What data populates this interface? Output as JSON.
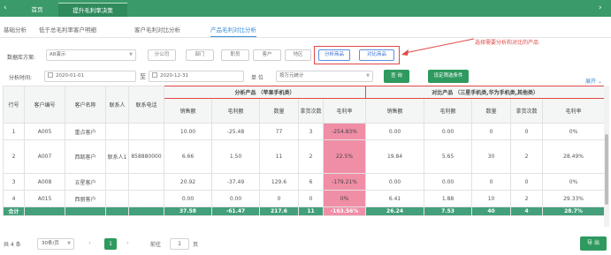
{
  "topbar": {
    "back_icon": "‹",
    "forward_icon": "›",
    "tabs": [
      {
        "label": "首页"
      },
      {
        "label": "提升毛利率决策"
      }
    ]
  },
  "subtabs": [
    "基础分析",
    "低于总毛利率客户明细",
    "客户毛利对比分析",
    "产品毛利对比分析"
  ],
  "filters": {
    "scheme_label": "数据库方案:",
    "scheme_value": "A8演示",
    "dims": [
      "分公司",
      "部门",
      "职员",
      "客户",
      "地区"
    ],
    "analysis_btn": "分析商品",
    "compare_btn": "对比商品",
    "annotation": "选择需要分析和对比的产品",
    "time_label": "分析时间:",
    "date_from": "2020-01-01",
    "to_label": "至",
    "date_to": "2020-12-31",
    "unit_label": "单 位",
    "unit_value": "按万元统计",
    "query_btn": "查 询",
    "set_cond_btn": "设定筛选条件",
    "expand": "展开"
  },
  "table": {
    "group_analysis": "分析产品 （苹果手机类）",
    "group_compare": "对比产品 （三星手机类,华为手机类,其他类）",
    "fixed_headers": [
      "行号",
      "客户编号",
      "客户名称",
      "联系人",
      "联系电话"
    ],
    "metric_headers": [
      "销售额",
      "毛利额",
      "数量",
      "拿货次数",
      "毛利率"
    ],
    "rows": [
      {
        "no": "1",
        "code": "A005",
        "name": "重点客户",
        "contact": "",
        "phone": "",
        "a": [
          "10.00",
          "-25.48",
          "77",
          "3",
          "-254.83%"
        ],
        "c": [
          "0.00",
          "0.00",
          "0",
          "0",
          "0%"
        ]
      },
      {
        "no": "2",
        "code": "A007",
        "name": "西瓯客户",
        "contact": "联系人1",
        "phone": "858880000",
        "a": [
          "6.66",
          "1.50",
          "11",
          "2",
          "22.5%"
        ],
        "c": [
          "19.84",
          "5.65",
          "30",
          "2",
          "28.49%"
        ]
      },
      {
        "no": "3",
        "code": "A008",
        "name": "五星客户",
        "contact": "",
        "phone": "",
        "a": [
          "20.92",
          "-37.49",
          "129.6",
          "6",
          "-179.21%"
        ],
        "c": [
          "0.00",
          "0.00",
          "0",
          "0",
          "0%"
        ]
      },
      {
        "no": "4",
        "code": "A015",
        "name": "西丽客户",
        "contact": "",
        "phone": "",
        "a": [
          "0.00",
          "0.00",
          "0",
          "0",
          "0%"
        ],
        "c": [
          "6.41",
          "1.88",
          "10",
          "2",
          "29.33%"
        ]
      }
    ],
    "total": {
      "label": "合计",
      "a": [
        "37.58",
        "-61.47",
        "217.6",
        "11",
        "-163.56%"
      ],
      "c": [
        "26.24",
        "7.53",
        "40",
        "4",
        "28.7%"
      ]
    }
  },
  "pager": {
    "total": "共 4 条",
    "per_page": "30条/页",
    "prev": "‹",
    "page": "1",
    "next": "›",
    "goto_label": "前往",
    "goto_value": "1",
    "page_suffix": "页"
  },
  "export_btn": "导 出",
  "colors": {
    "primary": "#3a9a6a",
    "highlight": "#f08ea6",
    "total_row": "#43a07a",
    "annotation": "#e04848"
  }
}
